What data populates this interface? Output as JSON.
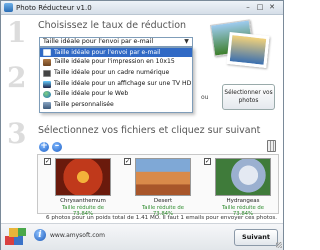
{
  "window": {
    "title": "Photo Réducteur v1.0",
    "controls": [
      "–",
      "□",
      "✕"
    ]
  },
  "steps": {
    "one": "1",
    "two": "2",
    "three": "3"
  },
  "section1": {
    "heading": "Choisissez le taux de réduction",
    "selected": "Taille idéale pour l'envoi par e-mail",
    "options": [
      {
        "label": "Taille idéale pour l'envoi par e-mail",
        "icon": "email-icon",
        "color": "#3a7bd5"
      },
      {
        "label": "Taille idéale pour l'impression en 10x15",
        "icon": "printer-icon",
        "color": "#8b5a2b"
      },
      {
        "label": "Taille idéale pour un cadre numérique",
        "icon": "frame-icon",
        "color": "#555555"
      },
      {
        "label": "Taille idéale pour un affichage sur une TV HD",
        "icon": "tv-icon",
        "color": "#333333"
      },
      {
        "label": "Taille idéale pour le Web",
        "icon": "globe-icon",
        "color": "#2a8ad4"
      },
      {
        "label": "Taille personnalisée",
        "icon": "custom-icon",
        "color": "#4a6a8a"
      }
    ]
  },
  "section2": {
    "or_label": "ou",
    "select_button": "Sélectionner vos photos"
  },
  "section3": {
    "heading": "Sélectionnez vos fichiers et cliquez sur suivant",
    "add_symbol": "+",
    "remove_symbol": "–",
    "files": [
      {
        "name": "Chrysanthemum",
        "note": "Taille réduite de 73.84%",
        "checked": "✓",
        "colors": [
          "#c0391b",
          "#f08a24"
        ]
      },
      {
        "name": "Desert",
        "note": "Taille réduite de 73.84%",
        "checked": "✓",
        "colors": [
          "#c9662f",
          "#7fa8d6"
        ]
      },
      {
        "name": "Hydrangeas",
        "note": "Taille réduite de 73.84%",
        "checked": "✓",
        "colors": [
          "#3f7b3a",
          "#c9d4e6"
        ]
      }
    ]
  },
  "status_text": "6 photos pour un poids total de 1.41 MO. Il faut 1 emails pour envoyer ces photos.",
  "footer": {
    "info_symbol": "i",
    "url": "www.amysoft.com",
    "next_button": "Suivant"
  }
}
